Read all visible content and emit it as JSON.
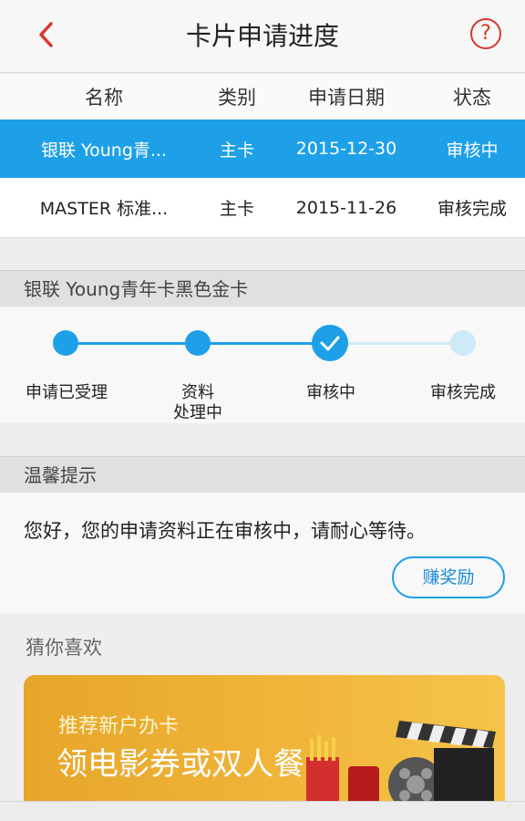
{
  "header": {
    "title": "卡片申请进度",
    "help_label": "?"
  },
  "table": {
    "columns": [
      "名称",
      "类别",
      "申请日期",
      "状态"
    ],
    "rows": [
      {
        "name": "银联 Young青...",
        "type": "主卡",
        "date": "2015-12-30",
        "status": "审核中"
      },
      {
        "name": "MASTER 标准...",
        "type": "主卡",
        "date": "2015-11-26",
        "status": "审核完成"
      }
    ]
  },
  "progress": {
    "card_title": "银联 Young青年卡黑色金卡",
    "steps": [
      "申请已受理",
      "资料\n处理中",
      "审核中",
      "审核完成"
    ],
    "current_step": 3,
    "colors": {
      "active": "#1ea0e8",
      "inactive": "#cfeaf7"
    }
  },
  "tips": {
    "title": "温馨提示",
    "message": "您好，您的申请资料正在审核中，请耐心等待。",
    "reward_button": "赚奖励"
  },
  "recommend": {
    "title": "猜你喜欢",
    "banner_small": "推荐新户办卡",
    "banner_big": "领电影券或双人餐"
  }
}
